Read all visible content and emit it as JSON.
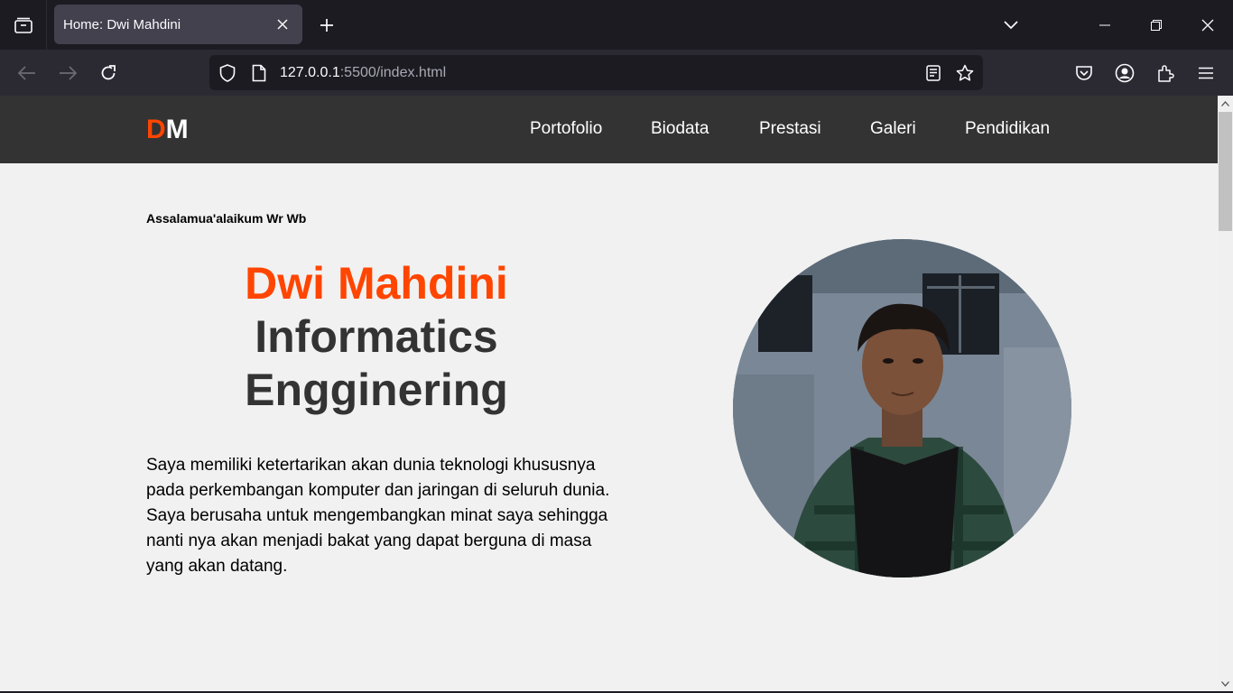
{
  "browser": {
    "tab_title": "Home: Dwi Mahdini",
    "url_host": "127.0.0.1",
    "url_rest": ":5500/index.html"
  },
  "site": {
    "logo_first": "D",
    "logo_second": "M",
    "menu": [
      "Portofolio",
      "Biodata",
      "Prestasi",
      "Galeri",
      "Pendidikan"
    ]
  },
  "hero": {
    "greeting": "Assalamua'alaikum Wr Wb",
    "name": "Dwi Mahdini",
    "role_line1": "Informatics",
    "role_line2": "Engginering",
    "description": "Saya memiliki ketertarikan akan dunia teknologi khususnya pada perkembangan komputer dan jaringan di seluruh dunia. Saya berusaha untuk mengembangkan minat saya sehingga nanti nya akan menjadi bakat yang dapat berguna di masa yang akan datang."
  },
  "colors": {
    "accent": "#ff4500",
    "header_bg": "#333333",
    "page_bg": "#f1f1f1"
  }
}
